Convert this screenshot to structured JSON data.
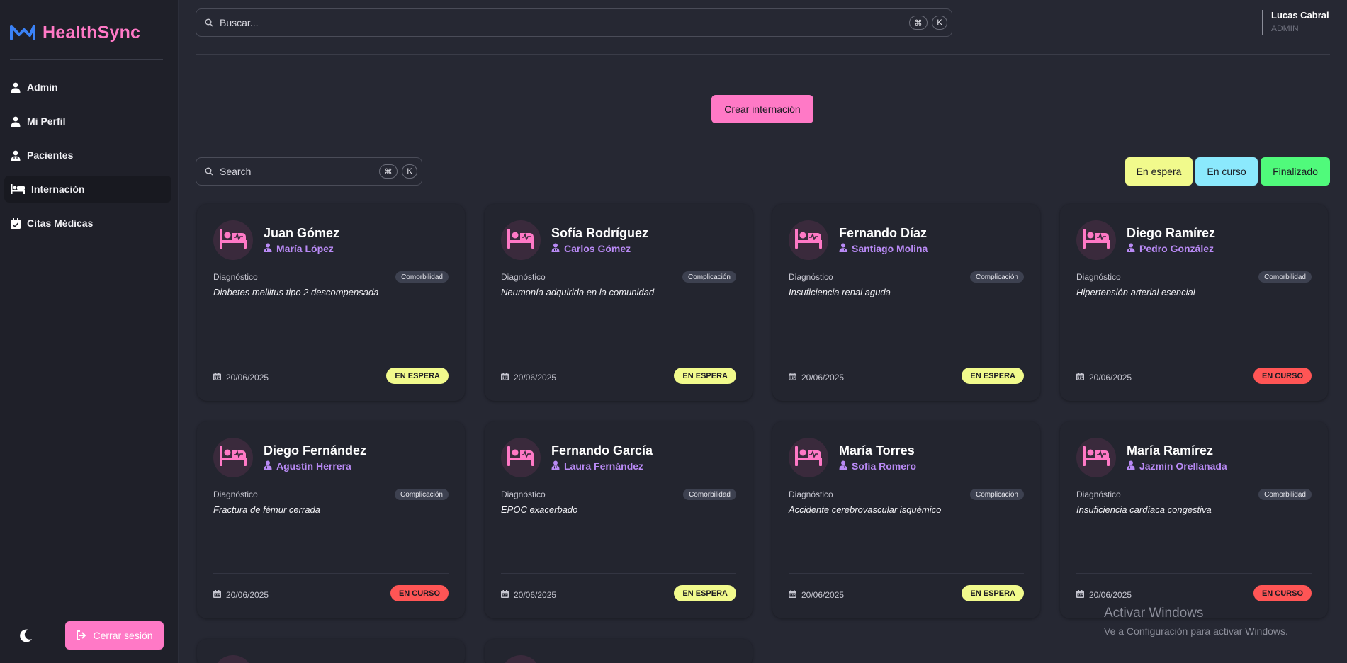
{
  "app": {
    "name": "HealthSync",
    "brand_color": "#ff79c6"
  },
  "sidebar": {
    "items": [
      {
        "label": "Admin",
        "icon": "user-icon"
      },
      {
        "label": "Mi Perfil",
        "icon": "user-icon"
      },
      {
        "label": "Pacientes",
        "icon": "user-doctor-icon"
      },
      {
        "label": "Internación",
        "icon": "bed-icon",
        "active": true
      },
      {
        "label": "Citas Médicas",
        "icon": "calendar-check-icon"
      }
    ],
    "theme_icon": "moon-icon",
    "logout_label": "Cerrar sesión"
  },
  "header": {
    "search_placeholder": "Buscar...",
    "shortcut_cmd": "⌘",
    "shortcut_key": "K",
    "user": {
      "name": "Lucas Cabral",
      "role": "ADMIN"
    }
  },
  "main": {
    "create_label": "Crear internación",
    "search_placeholder": "Search",
    "shortcut_cmd": "⌘",
    "shortcut_key": "K",
    "filters": [
      {
        "label": "En espera",
        "color": "#f1fa8c"
      },
      {
        "label": "En curso",
        "color": "#8be9fd"
      },
      {
        "label": "Finalizado",
        "color": "#50fa7b"
      }
    ],
    "diag_label": "Diagnóstico",
    "cards": [
      {
        "patient": "Juan Gómez",
        "doctor": "María López",
        "type": "Comorbilidad",
        "diagnosis": "Diabetes mellitus tipo 2 descompensada",
        "date": "20/06/2025",
        "status": "EN ESPERA"
      },
      {
        "patient": "Sofía Rodríguez",
        "doctor": "Carlos Gómez",
        "type": "Complicación",
        "diagnosis": "Neumonía adquirida en la comunidad",
        "date": "20/06/2025",
        "status": "EN ESPERA"
      },
      {
        "patient": "Fernando Díaz",
        "doctor": "Santiago Molina",
        "type": "Complicación",
        "diagnosis": "Insuficiencia renal aguda",
        "date": "20/06/2025",
        "status": "EN ESPERA"
      },
      {
        "patient": "Diego Ramírez",
        "doctor": "Pedro González",
        "type": "Comorbilidad",
        "diagnosis": "Hipertensión arterial esencial",
        "date": "20/06/2025",
        "status": "EN CURSO"
      },
      {
        "patient": "Diego Fernández",
        "doctor": "Agustín Herrera",
        "type": "Complicación",
        "diagnosis": "Fractura de fémur cerrada",
        "date": "20/06/2025",
        "status": "EN CURSO"
      },
      {
        "patient": "Fernando García",
        "doctor": "Laura Fernández",
        "type": "Comorbilidad",
        "diagnosis": "EPOC exacerbado",
        "date": "20/06/2025",
        "status": "EN ESPERA"
      },
      {
        "patient": "María Torres",
        "doctor": "Sofía Romero",
        "type": "Complicación",
        "diagnosis": "Accidente cerebrovascular isquémico",
        "date": "20/06/2025",
        "status": "EN ESPERA"
      },
      {
        "patient": "María Ramírez",
        "doctor": "Jazmin Orellanada",
        "type": "Comorbilidad",
        "diagnosis": "Insuficiencia cardíaca congestiva",
        "date": "20/06/2025",
        "status": "EN CURSO"
      }
    ],
    "status_colors": {
      "EN ESPERA": "#f1fa8c",
      "EN CURSO": "#ff5555"
    }
  },
  "watermark": {
    "title": "Activar Windows",
    "subtitle": "Ve a Configuración para activar Windows."
  }
}
